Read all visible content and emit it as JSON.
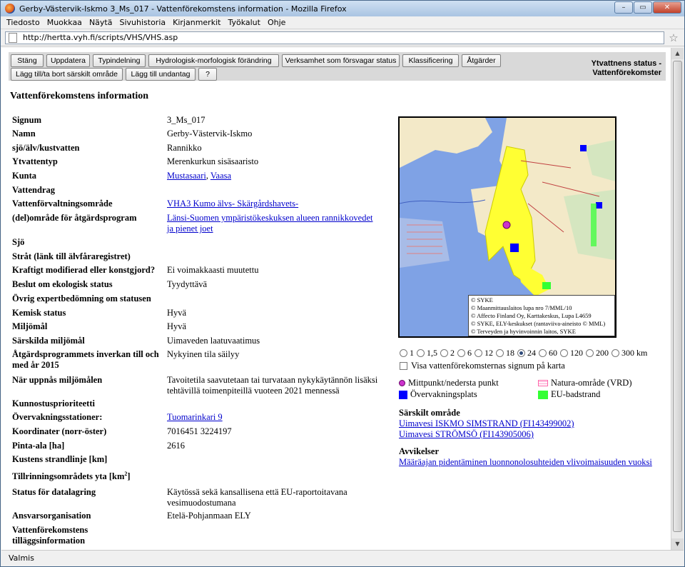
{
  "window": {
    "title": "Gerby-Västervik-Iskmo 3_Ms_017 - Vattenförekomstens information - Mozilla Firefox"
  },
  "menu": [
    "Tiedosto",
    "Muokkaa",
    "Näytä",
    "Sivuhistoria",
    "Kirjanmerkit",
    "Työkalut",
    "Ohje"
  ],
  "address": {
    "url": "http://hertta.vyh.fi/scripts/VHS/VHS.asp"
  },
  "toolbar": {
    "buttons_row1": [
      "Stäng",
      "Uppdatera",
      "Typindelning",
      "Hydrologisk-morfologisk förändring",
      "Verksamhet som försvagar status",
      "Klassificering",
      "Åtgärder"
    ],
    "buttons_row2": [
      "Lägg till/ta bort särskilt område",
      "Lägg till undantag",
      "?"
    ],
    "right_line1": "Ytvattnens status -",
    "right_line2": "Vattenförekomster"
  },
  "page_title": "Vattenförekomstens information",
  "fields": [
    {
      "label": "Signum",
      "value": "3_Ms_017"
    },
    {
      "label": "Namn",
      "value": "Gerby-Västervik-Iskmo"
    },
    {
      "label": "sjö/älv/kustvatten",
      "value": "Rannikko"
    },
    {
      "label": "Ytvattentyp",
      "value": "Merenkurkun sisäsaaristo"
    },
    {
      "label": "Kunta",
      "value": "",
      "links": [
        "Mustasaari",
        "Vaasa"
      ]
    },
    {
      "label": "Vattendrag",
      "value": ""
    },
    {
      "label": "Vattenförvaltningsområde",
      "value": "",
      "links": [
        "VHA3 Kumo älvs- Skärgårdshavets-"
      ]
    },
    {
      "label": "(del)område för åtgärdsprogram",
      "value": "",
      "links": [
        "Länsi-Suomen ympäristökeskuksen alueen rannikkovedet ja pienet joet"
      ]
    },
    {
      "label": "Sjö",
      "value": ""
    },
    {
      "label": "Stråt (länk till älvfåraregistret)",
      "value": ""
    },
    {
      "label": "Kraftigt modifierad eller konstgjord?",
      "value": "Ei voimakkaasti muutettu"
    },
    {
      "label": "Beslut om ekologisk status",
      "value": "Tyydyttävä"
    },
    {
      "label": "Övrig expertbedömning om statusen",
      "value": ""
    },
    {
      "label": "Kemisk status",
      "value": "Hyvä"
    },
    {
      "label": "Miljömål",
      "value": "Hyvä"
    },
    {
      "label": "Särskilda miljömål",
      "value": "Uimaveden laatuvaatimus"
    },
    {
      "label": "Åtgärdsprogrammets inverkan till och med år 2015",
      "value": "Nykyinen tila säilyy"
    },
    {
      "label": "När uppnås miljömålen",
      "value": "Tavoitetila saavutetaan tai turvataan nykykäytännön lisäksi tehtävillä toimenpiteillä vuoteen 2021 mennessä"
    },
    {
      "label": "Kunnostusprioriteetti",
      "value": ""
    },
    {
      "label": "Övervakningsstationer:",
      "value": "",
      "links": [
        "Tuomarinkari 9"
      ]
    },
    {
      "label": "Koordinater (norr-öster)",
      "value": "7016451 3224197"
    },
    {
      "label": "Pinta-ala [ha]",
      "value": "2616"
    },
    {
      "label": "Kustens strandlinje [km]",
      "value": ""
    },
    {
      "label": "Tillrinningsområdets yta [km",
      "sup": "2",
      "label_end": "]",
      "value": ""
    },
    {
      "label": "Status för datalagring",
      "value": "Käytössä sekä kansallisena että EU-raportoitavana vesimuodostumana"
    },
    {
      "label": "Ansvarsorganisation",
      "value": "Etelä-Pohjanmaan ELY"
    },
    {
      "label": "Vattenförekomstens tilläggsinformation",
      "value": ""
    }
  ],
  "map": {
    "copyright": [
      "© SYKE",
      "© Maanmittauslaitos lupa nro 7/MML/10",
      "© Affecto Finland Oy, Karttakeskus, Lupa L4659",
      "© SYKE, ELY-keskukset (rantaviiva-aineisto © MML)",
      "© Terveyden ja hyvinvoinnin laitos, SYKE"
    ],
    "scale_options": [
      "1",
      "1,5",
      "2",
      "6",
      "12",
      "18",
      "24",
      "60",
      "120",
      "200",
      "300 km"
    ],
    "selected_scale": "24",
    "checkbox_label": "Visa vattenförekomsternas signum på karta",
    "colors": {
      "water": "#7fa2e5",
      "waterbody": "#ffff33",
      "monitoring": "#0000ff",
      "midpoint": "#cc33cc",
      "natura": "#ff99cc",
      "beach": "#33ff33"
    }
  },
  "legend": {
    "midpoint": "Mittpunkt/nedersta punkt",
    "natura": "Natura-område (VRD)",
    "monitoring": "Övervakningsplats",
    "beach": "EU-badstrand"
  },
  "special_area": {
    "heading": "Särskilt område",
    "links": [
      "Uimavesi ISKMO SIMSTRAND (FI143499002)",
      "Uimavesi STRÖMSÖ (FI143905006)"
    ]
  },
  "deviations": {
    "heading": "Avvikelser",
    "links": [
      "Määräajan pidentäminen luonnonolosuhteiden vlivoimaisuuden vuoksi"
    ]
  },
  "status": "Valmis"
}
